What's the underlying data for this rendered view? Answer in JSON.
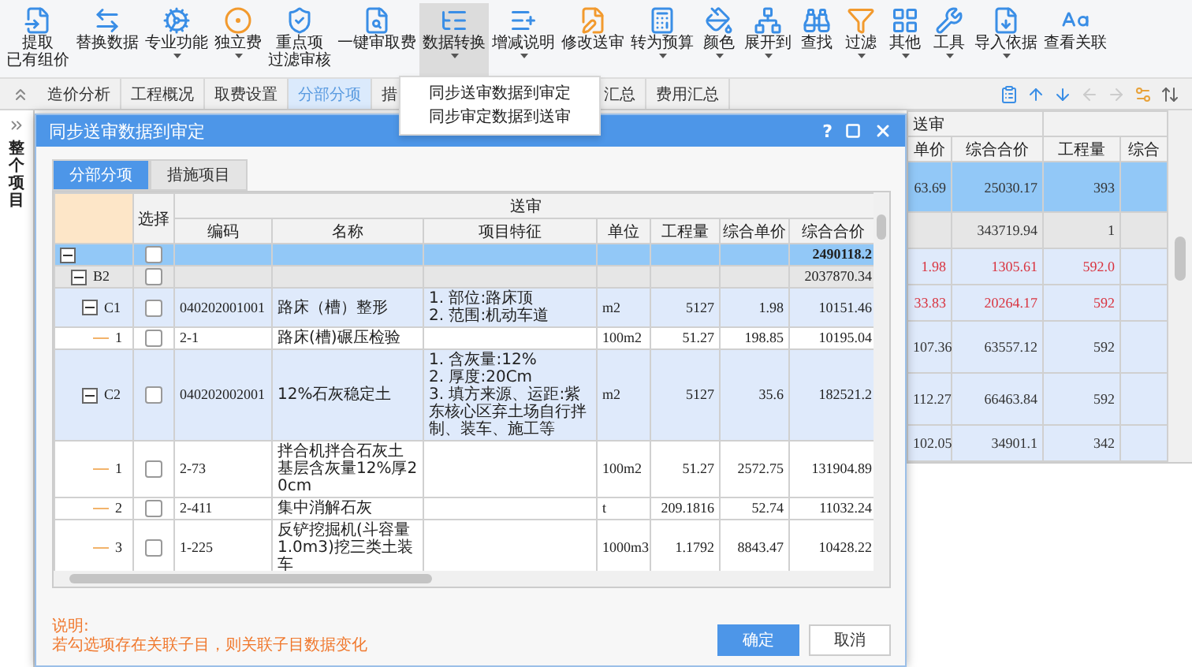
{
  "toolbar": {
    "items": [
      {
        "lines": [
          "提取",
          "已有组价"
        ],
        "dropdown": false,
        "active": false
      },
      {
        "label": "替换数据",
        "dropdown": false,
        "active": false
      },
      {
        "label": "专业功能",
        "dropdown": true,
        "active": false
      },
      {
        "label": "独立费",
        "dropdown": true,
        "active": false
      },
      {
        "lines": [
          "重点项",
          "过滤审核"
        ],
        "dropdown": false,
        "active": false
      },
      {
        "label": "一键审取费",
        "dropdown": false,
        "active": false
      },
      {
        "label": "数据转换",
        "dropdown": true,
        "active": true
      },
      {
        "label": "增减说明",
        "dropdown": true,
        "active": false
      },
      {
        "label": "修改送审",
        "dropdown": false,
        "active": false
      },
      {
        "label": "转为预算",
        "dropdown": true,
        "active": false
      },
      {
        "label": "颜色",
        "dropdown": true,
        "active": false
      },
      {
        "label": "展开到",
        "dropdown": true,
        "active": false
      },
      {
        "label": "查找",
        "dropdown": false,
        "active": false
      },
      {
        "label": "过滤",
        "dropdown": true,
        "active": false
      },
      {
        "label": "其他",
        "dropdown": true,
        "active": false
      },
      {
        "label": "工具",
        "dropdown": true,
        "active": false
      },
      {
        "label": "导入依据",
        "dropdown": true,
        "active": false
      },
      {
        "label": "查看关联",
        "dropdown": false,
        "active": false
      }
    ]
  },
  "dropdown_menu": {
    "items": [
      "同步送审数据到审定",
      "同步审定数据到送审"
    ]
  },
  "tabs": [
    {
      "label": "造价分析",
      "selected": false
    },
    {
      "label": "工程概况",
      "selected": false
    },
    {
      "label": "取费设置",
      "selected": false
    },
    {
      "label": "分部分项",
      "selected": true
    },
    {
      "label": "措",
      "selected": false
    },
    {
      "label": "汇总",
      "selected": false
    },
    {
      "label": "费用汇总",
      "selected": false
    }
  ],
  "side_panel": {
    "title": "整个项目"
  },
  "background_table": {
    "group": "送审",
    "columns": [
      "单价",
      "综合合价",
      "工程量",
      "综合"
    ],
    "rows": [
      {
        "kind": "selected",
        "changed": false,
        "cells": [
          "63.69",
          "25030.17",
          "393",
          ""
        ]
      },
      {
        "kind": "group",
        "changed": false,
        "cells": [
          "",
          "343719.94",
          "1",
          ""
        ]
      },
      {
        "kind": "item",
        "changed": true,
        "cells": [
          "1.98",
          "1305.61",
          "592.0",
          ""
        ]
      },
      {
        "kind": "item",
        "changed": true,
        "cells": [
          "33.83",
          "20264.17",
          "592",
          ""
        ]
      },
      {
        "kind": "tall",
        "changed": false,
        "cells": [
          "107.36",
          "63557.12",
          "592",
          ""
        ]
      },
      {
        "kind": "tall",
        "changed": false,
        "cells": [
          "112.27",
          "66463.84",
          "592",
          ""
        ]
      },
      {
        "kind": "item",
        "changed": false,
        "cells": [
          "102.05",
          "34901.1",
          "342",
          ""
        ]
      }
    ]
  },
  "dialog": {
    "title": "同步送审数据到审定",
    "help": "?",
    "tabs": [
      {
        "label": "分部分项",
        "selected": true
      },
      {
        "label": "措施项目",
        "selected": false
      }
    ],
    "table": {
      "select_header": "选择",
      "group": "送审",
      "columns": [
        "编码",
        "名称",
        "项目特征",
        "单位",
        "工程量",
        "综合单价",
        "综合合价"
      ],
      "rows": [
        {
          "label": "",
          "kind": "root",
          "selected": true,
          "checked": false,
          "expanded": true,
          "cells": [
            "",
            "",
            "",
            "",
            "",
            "",
            "2490118.2"
          ],
          "children": [
            {
              "label": "B2",
              "kind": "group",
              "selected": false,
              "checked": false,
              "expanded": true,
              "cells": [
                "",
                "",
                "",
                "",
                "",
                "",
                "2037870.34"
              ],
              "children": [
                {
                  "label": "C1",
                  "kind": "item",
                  "selected": false,
                  "checked": false,
                  "expanded": true,
                  "cells": [
                    "040202001001",
                    "路床（槽）整形",
                    "1. 部位:路床顶\n2. 范围:机动车道",
                    "m2",
                    "5127",
                    "1.98",
                    "10151.46"
                  ],
                  "children": [
                    {
                      "label": "1",
                      "kind": "sub",
                      "selected": false,
                      "checked": false,
                      "cells": [
                        "2-1",
                        "路床(槽)碾压检验",
                        "",
                        "100m2",
                        "51.27",
                        "198.85",
                        "10195.04"
                      ]
                    }
                  ]
                },
                {
                  "label": "C2",
                  "kind": "item",
                  "selected": false,
                  "checked": false,
                  "expanded": true,
                  "cells": [
                    "040202002001",
                    "12%石灰稳定土",
                    "1. 含灰量:12%\n2. 厚度:20Cm\n3. 填方来源、运距:紫东核心区弃土场自行拌制、装车、施工等",
                    "m2",
                    "5127",
                    "35.6",
                    "182521.2"
                  ],
                  "children": [
                    {
                      "label": "1",
                      "kind": "sub",
                      "selected": false,
                      "checked": false,
                      "cells": [
                        "2-73",
                        "拌合机拌合石灰土基层含灰量12%厚20cm",
                        "",
                        "100m2",
                        "51.27",
                        "2572.75",
                        "131904.89"
                      ]
                    },
                    {
                      "label": "2",
                      "kind": "sub",
                      "selected": false,
                      "checked": false,
                      "cells": [
                        "2-411",
                        "集中消解石灰",
                        "",
                        "t",
                        "209.1816",
                        "52.74",
                        "11032.24"
                      ]
                    },
                    {
                      "label": "3",
                      "kind": "sub",
                      "selected": false,
                      "checked": false,
                      "cells": [
                        "1-225",
                        "反铲挖掘机(斗容量1.0m3)挖三类土装车",
                        "",
                        "1000m3",
                        "1.1792",
                        "8843.47",
                        "10428.22"
                      ]
                    }
                  ]
                }
              ]
            }
          ]
        }
      ]
    },
    "note": {
      "title": "说明:",
      "text": "若勾选项存在关联子目，则关联子目数据变化"
    },
    "buttons": [
      {
        "label": "确定",
        "kind": "primary"
      },
      {
        "label": "取消",
        "kind": "secondary"
      }
    ]
  }
}
